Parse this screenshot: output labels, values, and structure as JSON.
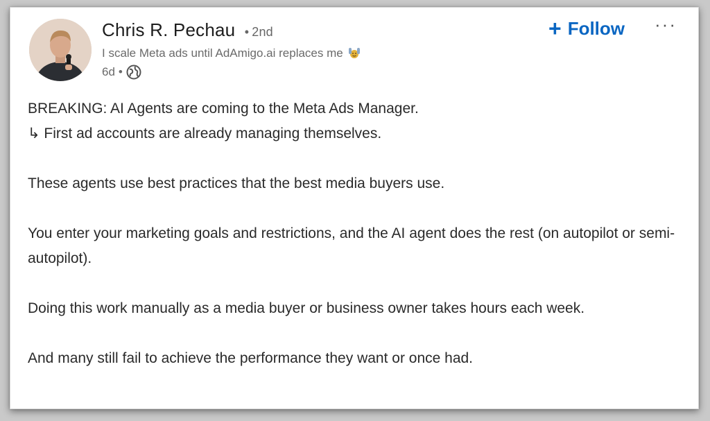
{
  "post": {
    "author_name": "Chris R. Pechau",
    "separator": "•",
    "degree": "2nd",
    "headline": "I scale Meta ads until AdAmigo.ai replaces me",
    "headline_emoji_icon": "raising-hands-emoji-icon",
    "age": "6d",
    "visibility_icon": "globe-icon",
    "follow_icon": "plus-icon",
    "follow_label": "Follow",
    "follow_color": "#0a66c2",
    "more_label": "···",
    "paragraphs": [
      [
        "BREAKING: AI Agents are coming to the Meta Ads Manager.",
        "↳ First ad accounts are already managing themselves."
      ],
      [
        "These agents use best practices that the best media buyers use."
      ],
      [
        "You enter your marketing goals and restrictions, and the AI agent does the rest (on autopilot or semi-autopilot)."
      ],
      [
        "Doing this work manually as a media buyer or business owner takes hours each week."
      ],
      [
        "And many still fail to achieve the performance they want or once had."
      ]
    ]
  }
}
